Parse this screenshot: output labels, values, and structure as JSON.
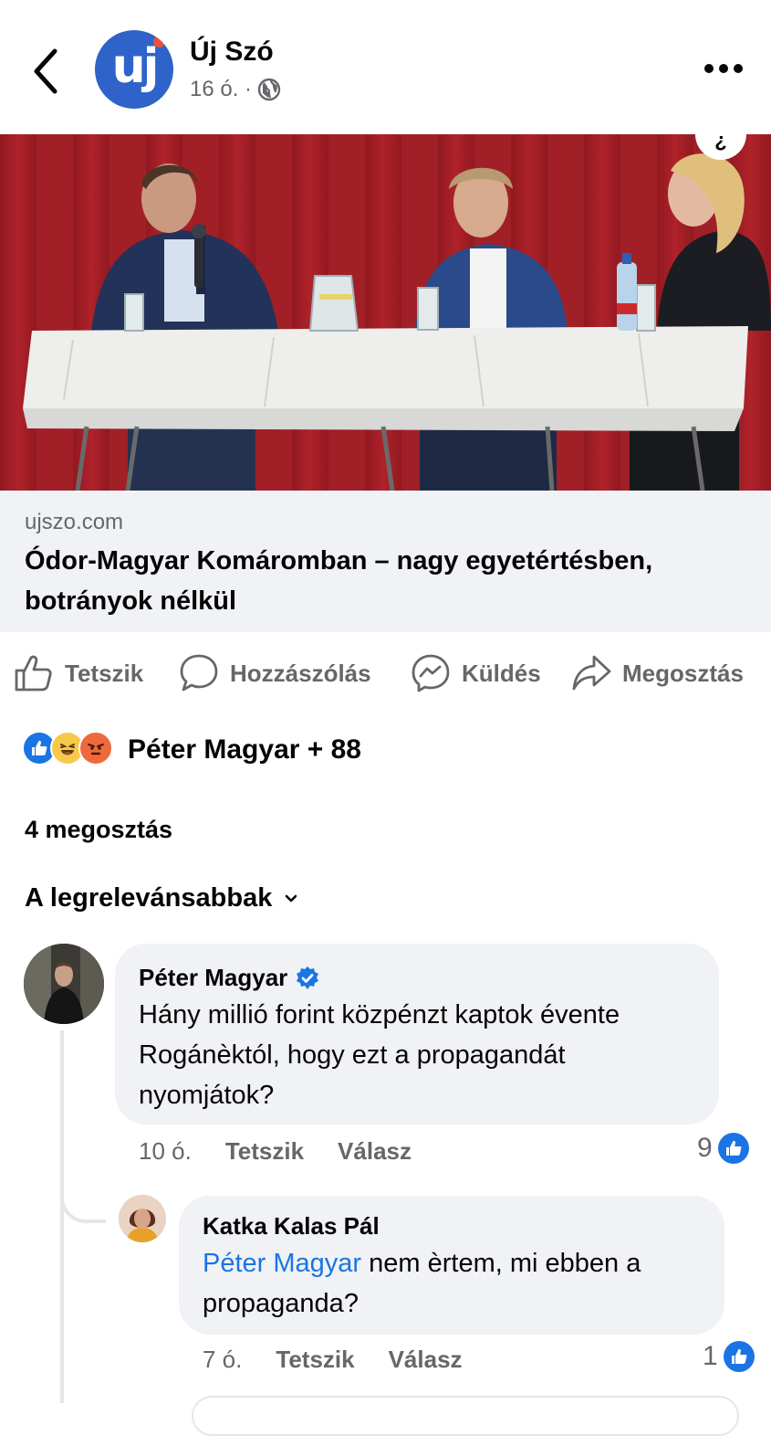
{
  "header": {
    "page_name": "Új Szó",
    "time": "16 ó. ·",
    "avatar_logo": "uj",
    "icons": [
      "back-arrow-icon",
      "globe-icon",
      "more-icon"
    ]
  },
  "link_preview": {
    "domain": "ujszo.com",
    "title": "Ódor-Magyar Komáromban – nagy egyetértésben, botrányok nélkül"
  },
  "actions": {
    "like": "Tetszik",
    "comment": "Hozzászólás",
    "send": "Küldés",
    "share": "Megosztás"
  },
  "reactions": {
    "types": [
      "like",
      "haha",
      "angry"
    ],
    "summary": "Péter Magyar + 88"
  },
  "shares": "4 megosztás",
  "sort": {
    "label": "A legrelevánsabbak"
  },
  "comments": [
    {
      "author": "Péter Magyar",
      "verified": true,
      "text": "Hány millió forint közpénzt kaptok évente Rogánèktól, hogy ezt a propagandát nyomjátok?",
      "time": "10 ó.",
      "like_label": "Tetszik",
      "reply_label": "Válasz",
      "like_count": "9"
    },
    {
      "author": "Katka Kalas Pál",
      "mention": "Péter Magyar",
      "text": "nem èrtem, mi ebben a propaganda?",
      "time": "7 ó.",
      "like_label": "Tetszik",
      "reply_label": "Válasz",
      "like_count": "1"
    }
  ],
  "colors": {
    "accent": "#1b74e4",
    "secondary_text": "#65676b",
    "bubble": "#f0f2f5"
  }
}
